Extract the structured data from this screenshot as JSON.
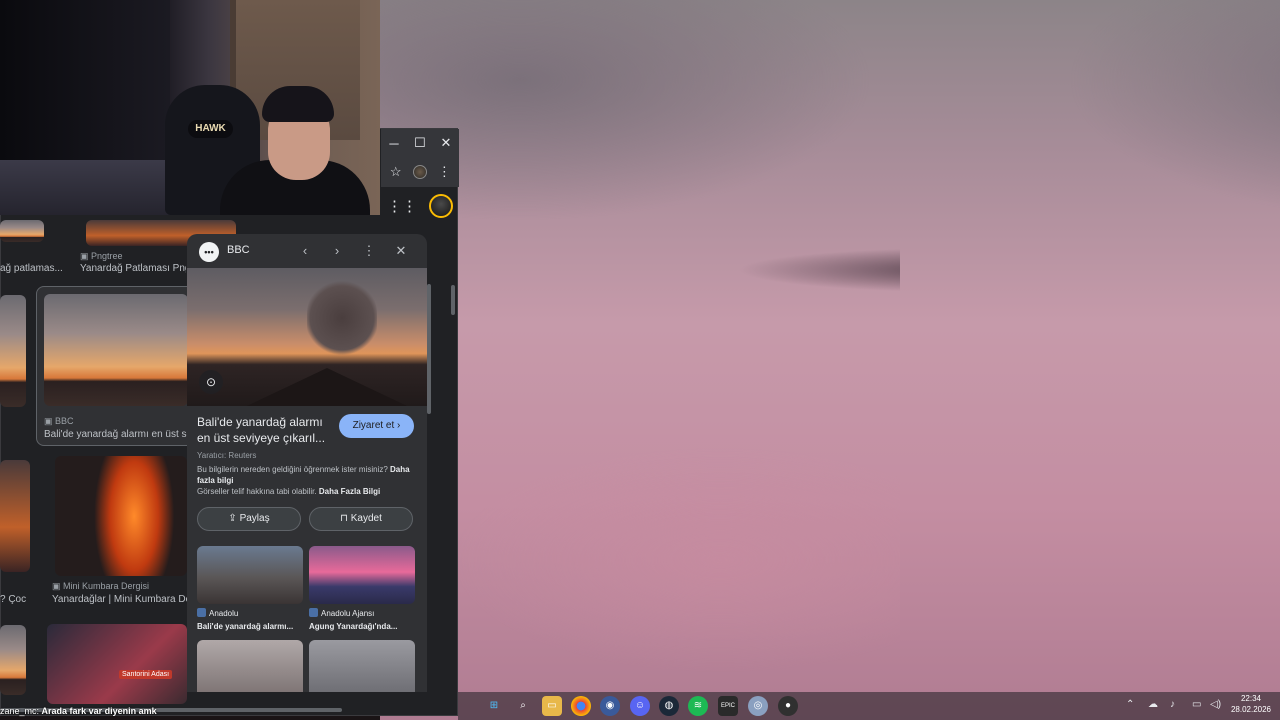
{
  "colors": {
    "accent": "#8ab4f8",
    "panel_bg": "#303134",
    "page_bg": "#202124"
  },
  "browser": {
    "window_controls": {
      "minimize": "─",
      "maximize": "☐",
      "close": "✕"
    },
    "toolbar": {
      "bookmark_icon": "star-icon",
      "menu": "⋮"
    }
  },
  "results": {
    "row1": [
      {
        "title": "ağ patlamas..."
      },
      {
        "source": "Pngtree",
        "title": "Yanardağ Patlaması Png"
      }
    ],
    "selected": {
      "source": "BBC",
      "title": "Bali'de yanardağ alarmı en üst se"
    },
    "row3": [
      {
        "title": "? Çoc"
      },
      {
        "source": "Mini Kumbara Dergisi",
        "title": "Yanardağlar | Mini Kumbara De"
      }
    ],
    "row4_label": "Santorini Adası"
  },
  "panel": {
    "source": "BBC",
    "source_logo": "•••",
    "title": "Bali'de yanardağ alarmı en üst seviyeye çıkarıl...",
    "visit_label": "Ziyaret et",
    "creator": "Yaratıcı: Reuters",
    "info_line1": "Bu bilgilerin nereden geldiğini öğrenmek ister misiniz?",
    "info_link1": "Daha fazla bilgi",
    "info_line2": "Görseller telif hakkına tabi olabilir.",
    "info_link2": "Daha Fazla Bilgi",
    "share_label": "Paylaş",
    "save_label": "Kaydet",
    "related": [
      {
        "source": "Anadolu",
        "title": "Bali'de yanardağ alarmı..."
      },
      {
        "source": "Anadolu Ajansı",
        "title": "Agung Yanardağı'nda..."
      }
    ]
  },
  "webcam": {
    "chair_logo": "HAWK"
  },
  "chat": {
    "user": "zane_mc:",
    "message": "Arada fark var diyenin amk"
  },
  "clock": {
    "time": "22:34",
    "date": "28.02.2026"
  }
}
